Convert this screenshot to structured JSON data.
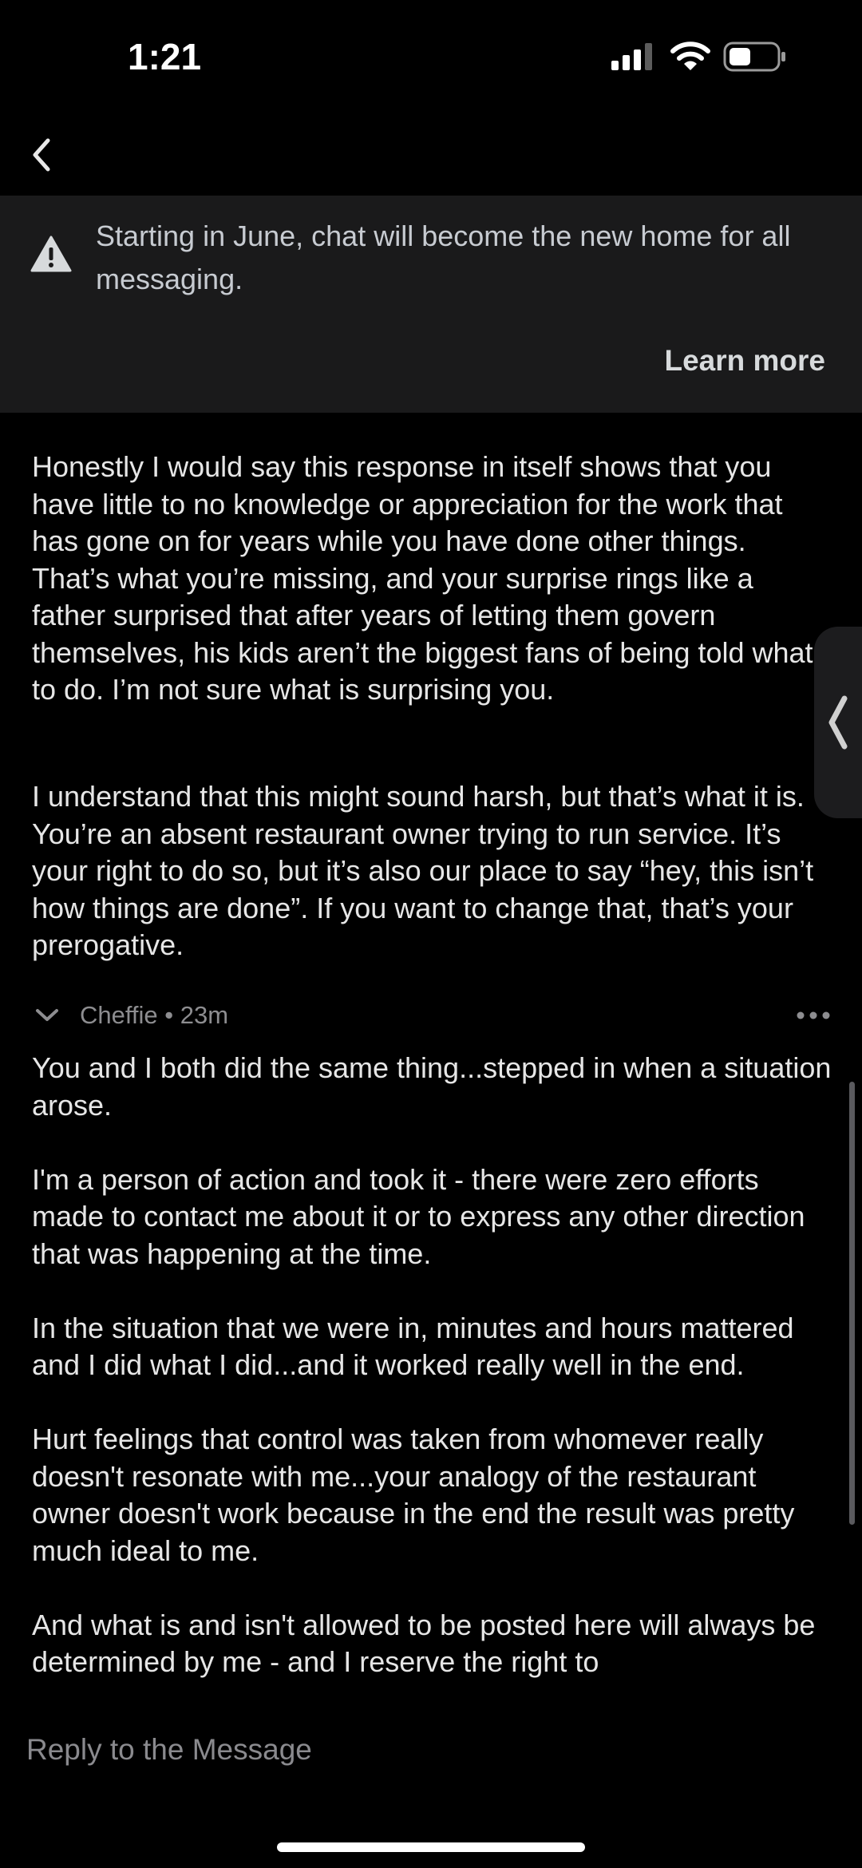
{
  "status_bar": {
    "time": "1:21"
  },
  "banner": {
    "text": "Starting in June, chat will become the new home for all messaging.",
    "action": "Learn more"
  },
  "message": {
    "paragraphs": [
      "Honestly I would say this response in itself shows that you have little to no knowledge or appreciation for the work that has gone on for years while you have done other things. That’s what you’re missing, and your surprise rings like a father surprised that after years of letting them govern themselves, his kids aren’t the biggest fans of being told what to do. I’m not sure what is surprising you.",
      "I understand that this might sound harsh, but that’s what it is. You’re an absent restaurant owner trying to run service. It’s your right to do so, but it’s also our place to say “hey, this isn’t how things are done”. If you want to change that, that’s your prerogative."
    ]
  },
  "comment": {
    "author": "Cheffie",
    "time": "23m",
    "meta": "Cheffie • 23m",
    "paragraphs": [
      "You and I both did the same thing...stepped in when a situation arose.",
      "I'm a person of action and took it - there were zero efforts made to contact me about it or to express any other direction that was happening at the time.",
      "In the situation that we were in, minutes and hours mattered and I did what I did...and it worked really well in the end.",
      "Hurt feelings that control was taken from whomever really doesn't resonate with me...your analogy of the restaurant owner doesn't work because in the end the result was pretty much ideal to me.",
      "And what is and isn't allowed to be posted here will always be determined by me - and I reserve the right to"
    ]
  },
  "reply": {
    "placeholder": "Reply to the Message"
  },
  "icons": [
    "signal-icon",
    "wifi-icon",
    "battery-icon",
    "back-icon",
    "warning-icon",
    "chevron-down-icon",
    "more-icon",
    "chevron-left-icon"
  ]
}
